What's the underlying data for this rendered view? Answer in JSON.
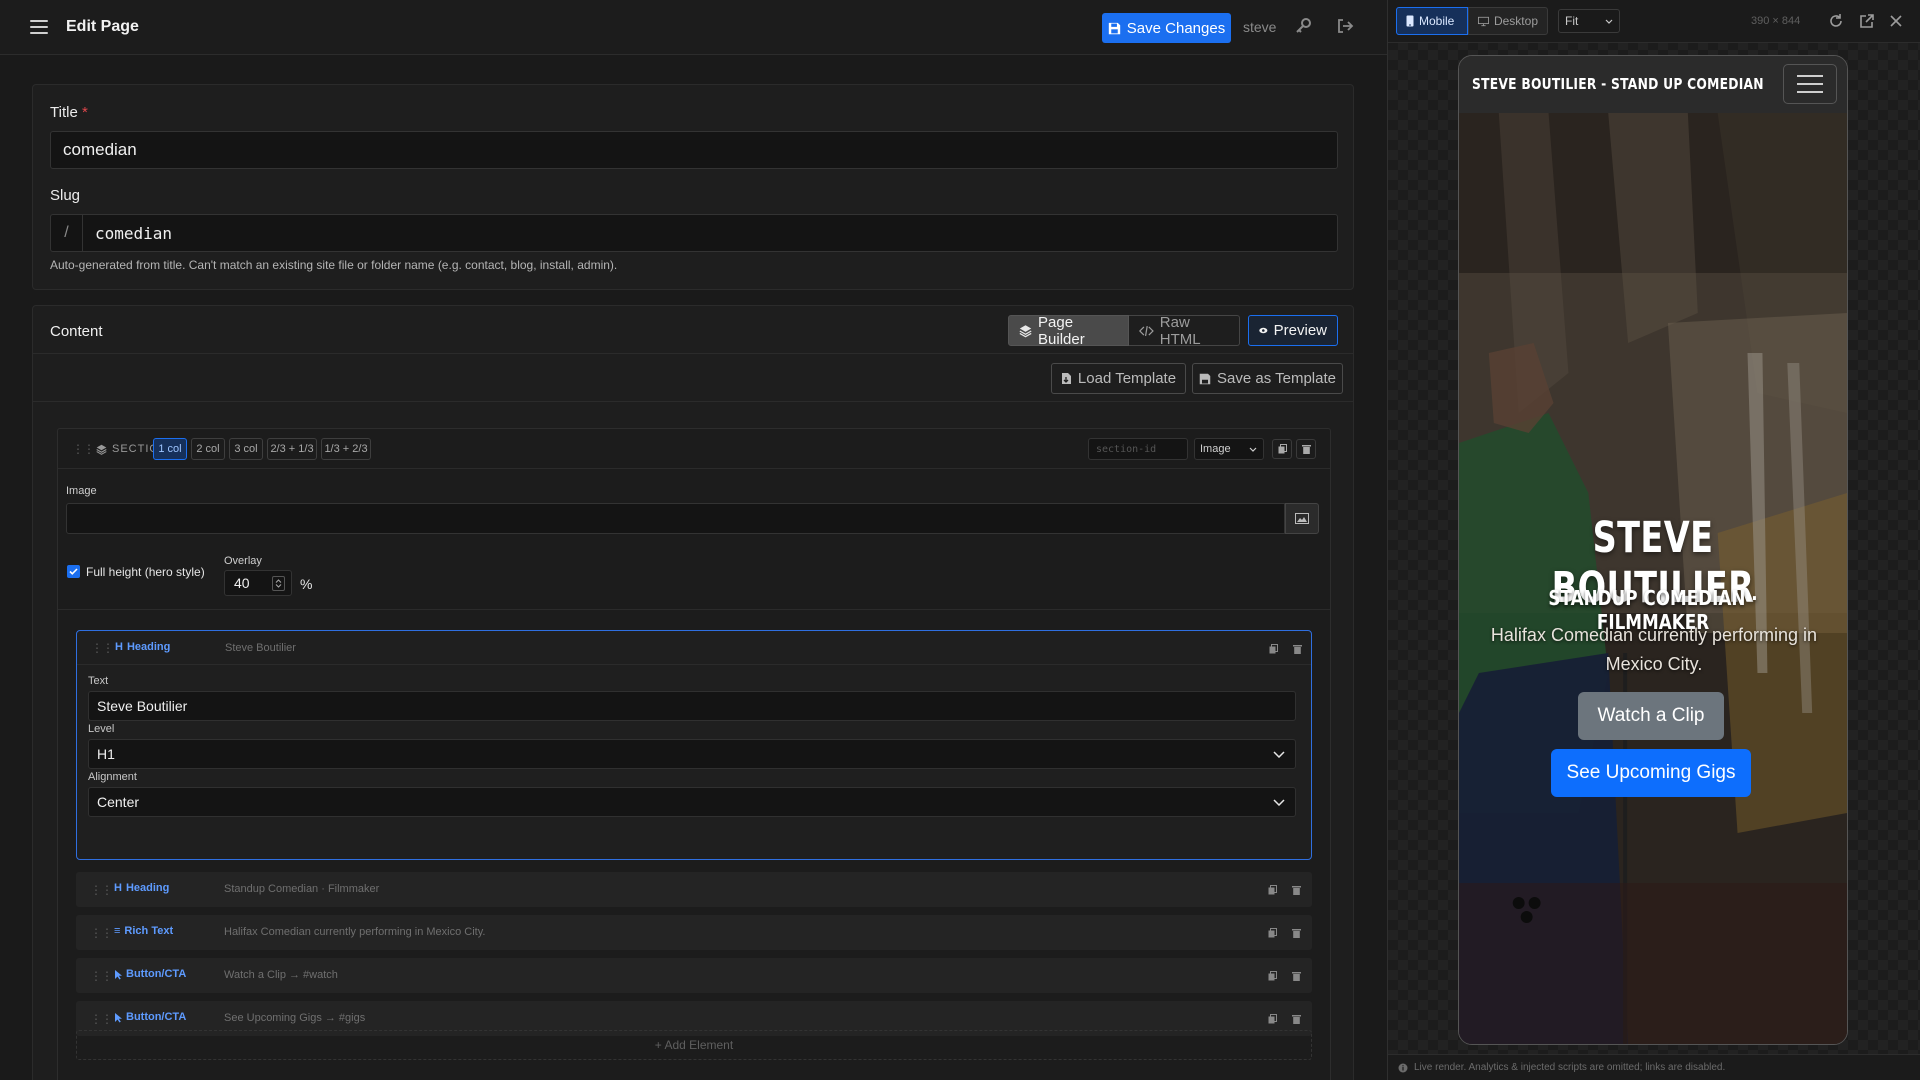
{
  "topbar": {
    "title": "Edit Page",
    "save_label": "Save Changes",
    "user": "steve"
  },
  "page_meta": {
    "title_label": "Title",
    "title_required": "*",
    "title_value": "comedian",
    "slug_label": "Slug",
    "slug_prefix": "/",
    "slug_value": "comedian",
    "slug_help": "Auto-generated from title. Can't match an existing site file or folder name (e.g. contact, blog, install, admin)."
  },
  "content": {
    "title": "Content",
    "modes": [
      "Page Builder",
      "Raw HTML"
    ],
    "preview_label": "Preview",
    "load_template": "Load Template",
    "save_template": "Save as Template"
  },
  "section": {
    "label": "SECTION",
    "columns": [
      "1 col",
      "2 col",
      "3 col",
      "2/3 + 1/3",
      "1/3 + 2/3"
    ],
    "active_column": "1 col",
    "id_placeholder": "section-id",
    "background_type": "Image",
    "image_label": "Image",
    "image_value": "",
    "full_height_label": "Full height (hero style)",
    "full_height_checked": true,
    "overlay_label": "Overlay",
    "overlay_value": "40",
    "overlay_unit": "%",
    "add_element": "+ Add Element"
  },
  "elements": [
    {
      "type": "Heading",
      "summary": "Steve Boutilier",
      "expanded": true,
      "fields": {
        "text_label": "Text",
        "text_value": "Steve Boutilier",
        "level_label": "Level",
        "level_value": "H1",
        "align_label": "Alignment",
        "align_value": "Center"
      }
    },
    {
      "type": "Heading",
      "summary": "Standup Comedian · Filmmaker"
    },
    {
      "type": "Rich Text",
      "summary": "Halifax Comedian currently performing in Mexico City."
    },
    {
      "type": "Button/CTA",
      "summary": "Watch a Clip → #watch"
    },
    {
      "type": "Button/CTA",
      "summary": "See Upcoming Gigs → #gigs"
    }
  ],
  "preview": {
    "tabs": [
      "Mobile",
      "Desktop"
    ],
    "active_tab": "Mobile",
    "zoom": "Fit",
    "dims": "390 × 844",
    "footer_note": "Live render. Analytics & injected scripts are omitted; links are disabled.",
    "site": {
      "brand": "STEVE BOUTILIER - STAND UP COMEDIAN",
      "hero_title": "STEVE BOUTILIER",
      "hero_subtitle": "STANDUP COMEDIAN · FILMMAKER",
      "hero_text": "Halifax Comedian currently performing in Mexico City.",
      "cta_1": "Watch a Clip",
      "cta_2": "See Upcoming Gigs"
    }
  },
  "colors": {
    "accent": "#1b6ff0",
    "required": "#e0474c",
    "element_type": "#5e9bff",
    "cta_secondary": "#6c757d",
    "cta_primary": "#0d6efd"
  }
}
